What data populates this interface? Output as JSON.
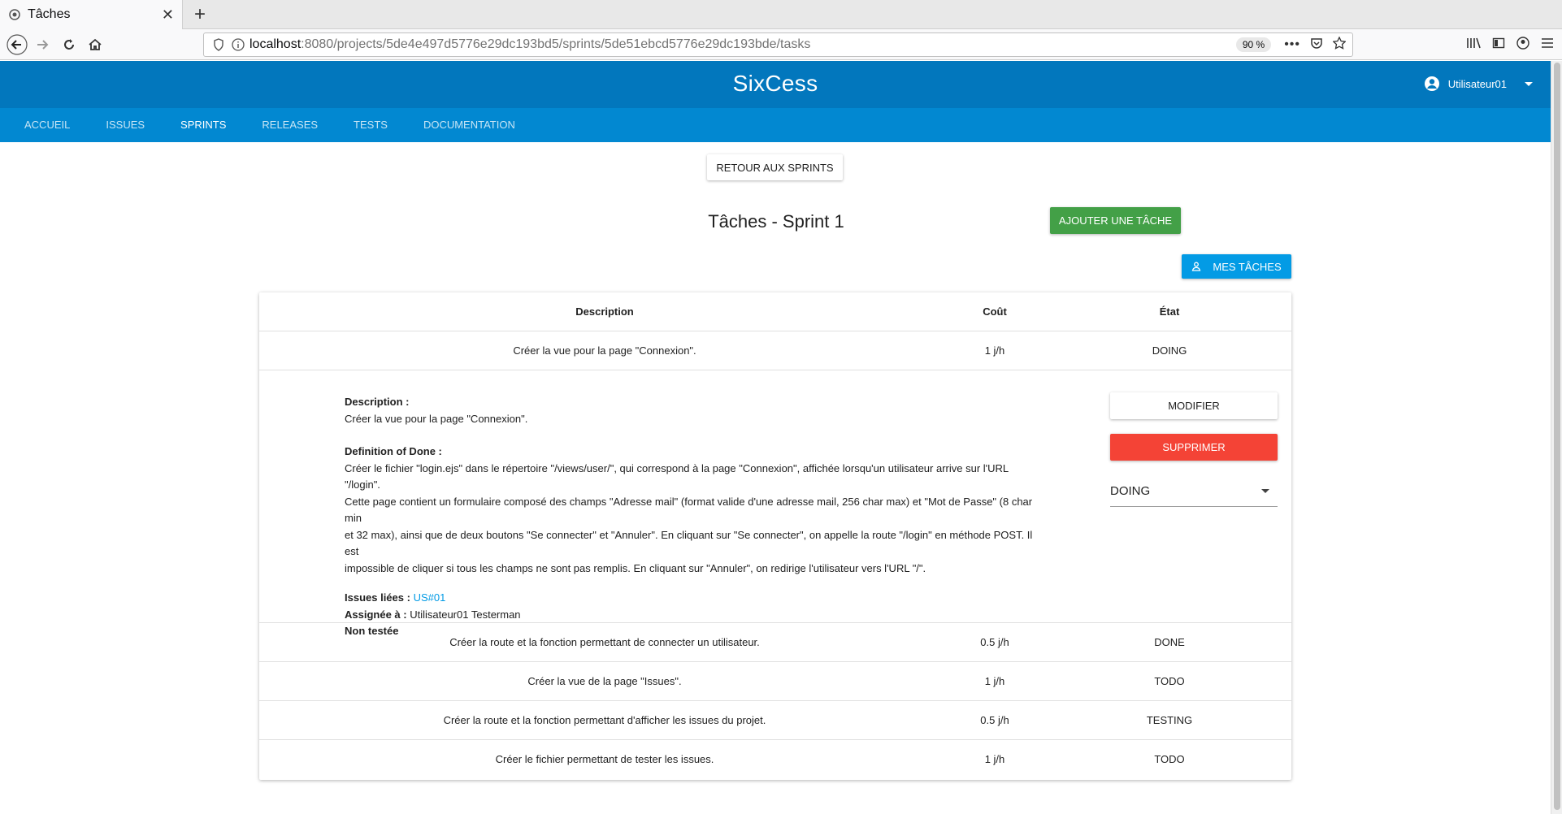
{
  "browser": {
    "tab_title": "Tâches",
    "url_host": "localhost",
    "url_rest": ":8080/projects/5de4e497d5776e29dc193bd5/sprints/5de51ebcd5776e29dc193bde/tasks",
    "zoom": "90 %"
  },
  "app": {
    "title": "SixCess",
    "user": "Utilisateur01",
    "tabs": [
      "ACCUEIL",
      "ISSUES",
      "SPRINTS",
      "RELEASES",
      "TESTS",
      "DOCUMENTATION"
    ],
    "active_tab": "SPRINTS"
  },
  "actions": {
    "back": "RETOUR AUX SPRINTS",
    "add": "AJOUTER UNE TÂCHE",
    "my_tasks": "MES TÂCHES"
  },
  "page_title": "Tâches - Sprint 1",
  "table": {
    "headers": [
      "Description",
      "Coût",
      "État"
    ],
    "rows": [
      {
        "description": "Créer la vue pour la page \"Connexion\".",
        "cost": "1 j/h",
        "state": "DOING"
      },
      {
        "description": "Créer la route et la fonction permettant de connecter un utilisateur.",
        "cost": "0.5 j/h",
        "state": "DONE"
      },
      {
        "description": "Créer la vue de la page \"Issues\".",
        "cost": "1 j/h",
        "state": "TODO"
      },
      {
        "description": "Créer la route et la fonction permettant d'afficher les issues du projet.",
        "cost": "0.5 j/h",
        "state": "TESTING"
      },
      {
        "description": "Créer le fichier permettant de tester les issues.",
        "cost": "1 j/h",
        "state": "TODO"
      }
    ]
  },
  "detail": {
    "description_label": "Description :",
    "description": "Créer la vue pour la page \"Connexion\".",
    "dod_label": "Definition of Done :",
    "dod_lines": [
      "Créer le fichier \"login.ejs\" dans le répertoire \"/views/user/\", qui correspond à la page \"Connexion\", affichée lorsqu'un utilisateur arrive sur l'URL \"/login\".",
      "Cette page contient un formulaire composé des champs \"Adresse mail\" (format valide d'une adresse mail, 256 char max) et \"Mot de Passe\" (8 char min",
      "et 32 max), ainsi que de deux boutons \"Se connecter\" et \"Annuler\". En cliquant sur \"Se connecter\", on appelle la route \"/login\" en méthode POST. Il est",
      "impossible de cliquer si tous les champs ne sont pas remplis. En cliquant sur \"Annuler\", on redirige l'utilisateur vers l'URL \"/\"."
    ],
    "issues_label": "Issues liées :",
    "issue_link": "US#01",
    "assigned_label": "Assignée à :",
    "assigned": "Utilisateur01 Testerman",
    "test_status": "Non testée",
    "modify": "MODIFIER",
    "delete": "SUPPRIMER",
    "state_value": "DOING"
  }
}
